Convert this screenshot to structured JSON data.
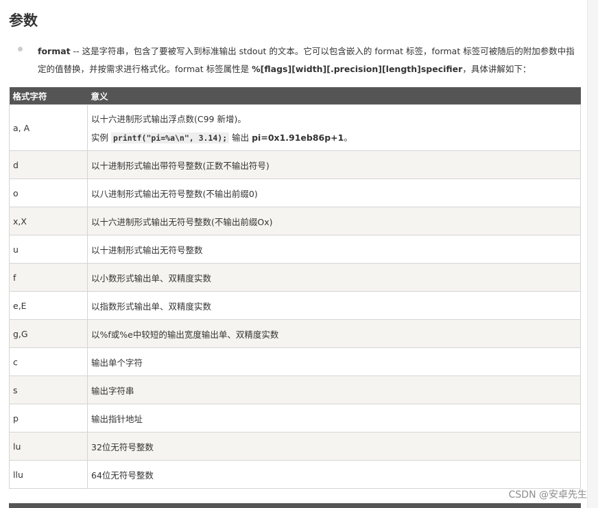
{
  "heading": "参数",
  "description": {
    "term": "format",
    "text1": " -- 这是字符串，包含了要被写入到标准输出 stdout 的文本。它可以包含嵌入的 format 标签，format 标签可被随后的附加参数中指定的值替换，并按需求进行格式化。format 标签属性是 ",
    "proto": "%[flags][width][.precision][length]specifier",
    "text2": "，具体讲解如下："
  },
  "table": {
    "headers": [
      "格式字符",
      "意义"
    ],
    "row_a": {
      "char": "a, A",
      "line1": "以十六进制形式输出浮点数(C99 新增)。",
      "example_prefix": "实例 ",
      "example_code": "printf(\"pi=%a\\n\", 3.14);",
      "example_mid": " 输出 ",
      "example_result": "pi=0x1.91eb86p+1",
      "example_end": "。"
    },
    "rows": [
      {
        "char": "d",
        "meaning": "以十进制形式输出带符号整数(正数不输出符号)"
      },
      {
        "char": "o",
        "meaning": "以八进制形式输出无符号整数(不输出前缀0)"
      },
      {
        "char": "x,X",
        "meaning": "以十六进制形式输出无符号整数(不输出前缀Ox)"
      },
      {
        "char": "u",
        "meaning": "以十进制形式输出无符号整数"
      },
      {
        "char": "f",
        "meaning": "以小数形式输出单、双精度实数"
      },
      {
        "char": "e,E",
        "meaning": "以指数形式输出单、双精度实数"
      },
      {
        "char": "g,G",
        "meaning": "以%f或%e中较短的输出宽度输出单、双精度实数"
      },
      {
        "char": "c",
        "meaning": "输出单个字符"
      },
      {
        "char": "s",
        "meaning": "输出字符串"
      },
      {
        "char": "p",
        "meaning": "输出指针地址"
      },
      {
        "char": "lu",
        "meaning": "32位无符号整数"
      },
      {
        "char": "llu",
        "meaning": "64位无符号整数"
      }
    ]
  },
  "watermark": "CSDN @安卓先生"
}
